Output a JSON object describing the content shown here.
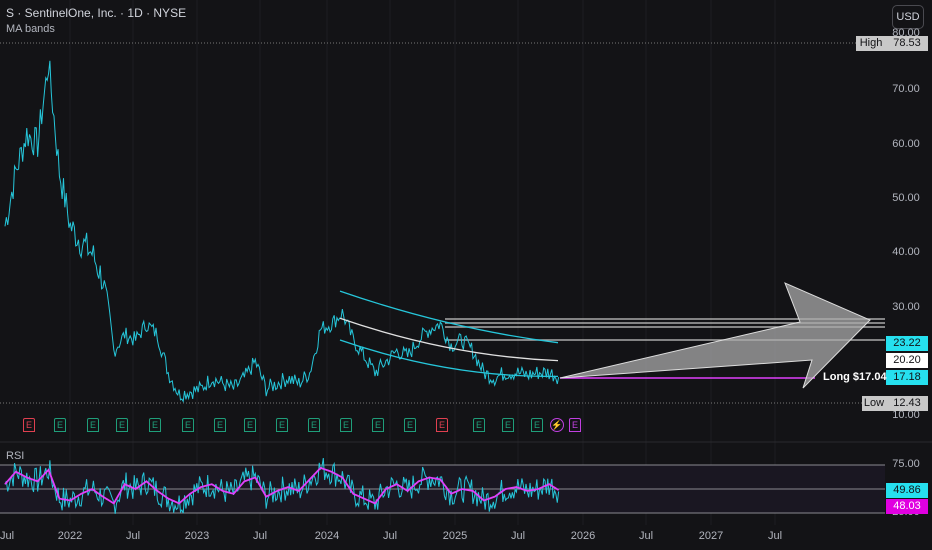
{
  "header": {
    "title": "S · SentinelOne, Inc. · 1D · NYSE",
    "indicator": "MA bands",
    "currency_button": "USD",
    "rsi_label": "RSI"
  },
  "price_axis": [
    "80.00",
    "70.00",
    "60.00",
    "50.00",
    "40.00",
    "30.00",
    "10.00"
  ],
  "rsi_axis": [
    "75.00",
    "25.00"
  ],
  "badges": {
    "high_label": "High",
    "high_value": "78.53",
    "low_label": "Low",
    "low_value": "12.43",
    "ma_upper": "23.22",
    "ma_mid": "20.20",
    "last": "17.18",
    "rsi": "49.86",
    "rsi_ma": "48.03",
    "long_label": "Long $17.04"
  },
  "x_axis": [
    "Jul",
    "2022",
    "Jul",
    "2023",
    "Jul",
    "2024",
    "Jul",
    "2025",
    "Jul",
    "2026",
    "Jul",
    "2027",
    "Jul"
  ],
  "events": [
    "E",
    "E",
    "E",
    "E",
    "E",
    "E",
    "E",
    "E",
    "E",
    "E",
    "E",
    "E",
    "E",
    "E",
    "E",
    "E",
    "E",
    "E"
  ],
  "event_colors": [
    "red",
    "green",
    "green",
    "green",
    "green",
    "green",
    "green",
    "green",
    "green",
    "green",
    "green",
    "green",
    "green",
    "red",
    "green",
    "green",
    "green",
    "green"
  ],
  "colors": {
    "price": "#26c6da",
    "rsi": "#26c6da",
    "rsi_ma": "#e040fb",
    "long": "#e040fb"
  },
  "chart_data": {
    "type": "line",
    "title": "S · SentinelOne, Inc. · 1D · NYSE",
    "ylim": [
      10,
      80
    ],
    "price_monthly": [
      45,
      55,
      62,
      60,
      75,
      55,
      45,
      42,
      40,
      35,
      22,
      25,
      24,
      27,
      25,
      18,
      14,
      14.5,
      15,
      17,
      16,
      15,
      17,
      20,
      15,
      16,
      17,
      16,
      18,
      26,
      27,
      29,
      24,
      21,
      18,
      20,
      22,
      21,
      24,
      26,
      27,
      23,
      24,
      22,
      18,
      17,
      18,
      18,
      17.5,
      18,
      18,
      17.2
    ],
    "rsi_monthly": [
      55,
      68,
      62,
      58,
      70,
      40,
      38,
      45,
      50,
      42,
      35,
      55,
      50,
      58,
      48,
      40,
      35,
      45,
      52,
      55,
      48,
      45,
      58,
      62,
      42,
      48,
      52,
      48,
      60,
      72,
      68,
      62,
      45,
      40,
      35,
      50,
      55,
      48,
      58,
      62,
      60,
      45,
      50,
      48,
      38,
      42,
      50,
      52,
      48,
      50,
      55,
      48
    ]
  }
}
